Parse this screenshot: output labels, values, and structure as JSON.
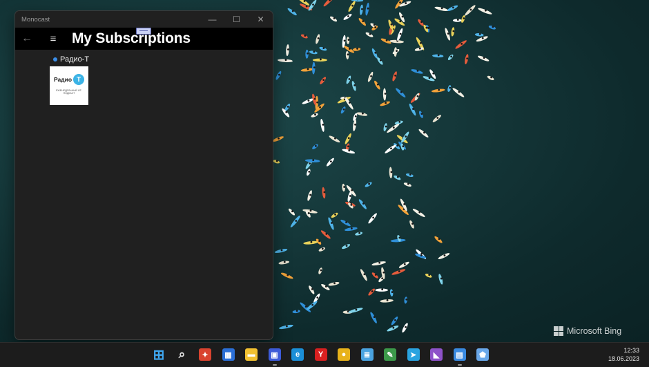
{
  "window": {
    "app_name": "Monocast",
    "controls": {
      "minimize": "—",
      "maximize": "☐",
      "close": "✕"
    }
  },
  "header": {
    "back_icon": "←",
    "menu_icon": "≡",
    "title": "My Subscriptions"
  },
  "subscriptions": [
    {
      "title": "Радио-Т",
      "unread": true,
      "cover_word": "Радио",
      "cover_letter": "Т",
      "cover_caption": "ЕЖЕНЕДЕЛЬНЫЙ ИТ-ПОДКАСТ"
    }
  ],
  "wallpaper": {
    "brand": "Microsoft Bing"
  },
  "taskbar": {
    "icons": [
      {
        "name": "start-icon",
        "glyph": "⊞",
        "color": "#3fa7f0",
        "running": false
      },
      {
        "name": "search-icon",
        "glyph": "⌕",
        "color": "#1c1c1c",
        "running": false
      },
      {
        "name": "app-red-icon",
        "glyph": "✦",
        "color": "#d9432f",
        "running": false
      },
      {
        "name": "store-icon",
        "glyph": "▦",
        "color": "#2b6fd6",
        "running": false
      },
      {
        "name": "file-explorer-icon",
        "glyph": "▬",
        "color": "#f2c131",
        "running": false
      },
      {
        "name": "save-disk-icon",
        "glyph": "▣",
        "color": "#3d5bd8",
        "running": true
      },
      {
        "name": "edge-icon",
        "glyph": "e",
        "color": "#1b8fd8",
        "running": false
      },
      {
        "name": "yandex-icon",
        "glyph": "Y",
        "color": "#d92020",
        "running": false
      },
      {
        "name": "chrome-icon",
        "glyph": "●",
        "color": "#e8b21a",
        "running": false
      },
      {
        "name": "notepad-icon",
        "glyph": "≣",
        "color": "#4aa3e0",
        "running": false
      },
      {
        "name": "editor-icon",
        "glyph": "✎",
        "color": "#3c9a4a",
        "running": false
      },
      {
        "name": "telegram-icon",
        "glyph": "➤",
        "color": "#2aa3e0",
        "running": false
      },
      {
        "name": "visual-studio-icon",
        "glyph": "◣",
        "color": "#8e52c9",
        "running": false
      },
      {
        "name": "podcast-app-icon",
        "glyph": "▤",
        "color": "#3a8ae0",
        "running": true
      },
      {
        "name": "pin-app-icon",
        "glyph": "⬟",
        "color": "#6aa8ea",
        "running": false
      }
    ],
    "clock": {
      "time": "12:33",
      "date": "18.06.2023"
    }
  }
}
